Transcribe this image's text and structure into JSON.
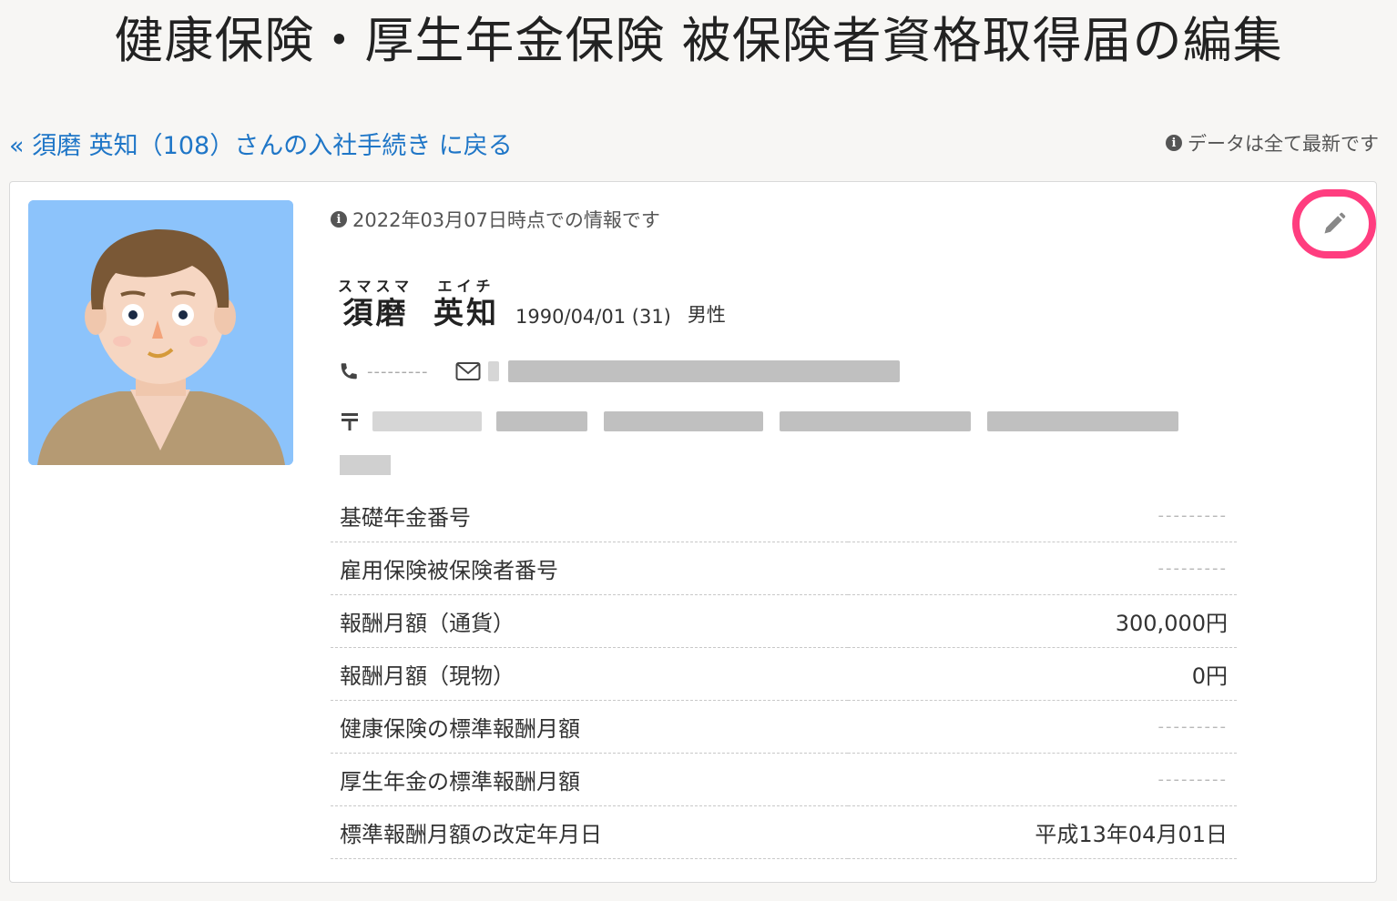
{
  "page": {
    "title": "健康保険・厚生年金保険 被保険者資格取得届の編集",
    "back_link": "« 須磨 英知（108）さんの入社手続き に戻る",
    "status_text": "データは全て最新です",
    "status_icon": "info-icon"
  },
  "card": {
    "as_of": "2022年03月07日時点での情報です",
    "edit_icon": "pencil-icon",
    "highlight_color": "#ff3d7f",
    "employee": {
      "last_kana": "スマスマ",
      "last_name": "須磨",
      "first_kana": "エイチ",
      "first_name": "英知",
      "birth": "1990/04/01 (31)",
      "gender": "男性"
    },
    "contact": {
      "phone_icon": "phone-icon",
      "phone": "---------",
      "email_icon": "envelope-icon",
      "postal_icon": "postal-mark-icon"
    },
    "fields": [
      {
        "label": "基礎年金番号",
        "value": "---------"
      },
      {
        "label": "雇用保険被保険者番号",
        "value": "---------"
      },
      {
        "label": "報酬月額（通貨）",
        "value": "300,000円"
      },
      {
        "label": "報酬月額（現物）",
        "value": "0円"
      },
      {
        "label": "健康保険の標準報酬月額",
        "value": "---------"
      },
      {
        "label": "厚生年金の標準報酬月額",
        "value": "---------"
      },
      {
        "label": "標準報酬月額の改定年月日",
        "value": "平成13年04月01日"
      }
    ]
  }
}
